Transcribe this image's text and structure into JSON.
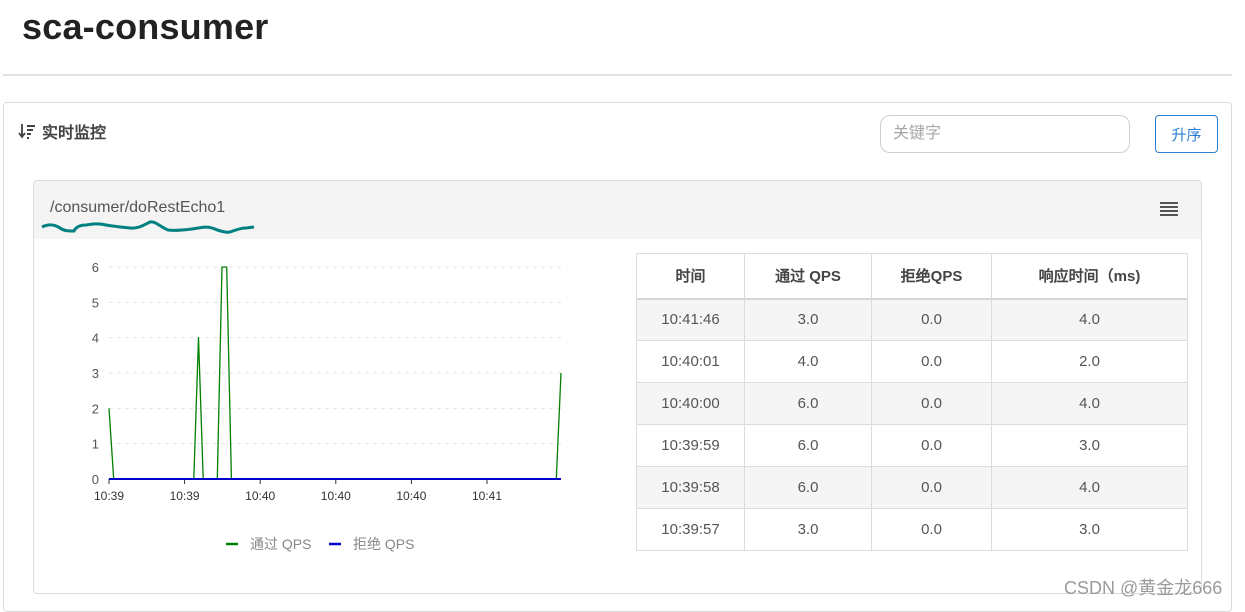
{
  "app": {
    "title": "sca-consumer"
  },
  "panel": {
    "heading": "实时监控",
    "search": {
      "placeholder": "关键字",
      "value": ""
    },
    "sort_button_label": "升序"
  },
  "resource": {
    "name": "/consumer/doRestEcho1",
    "table": {
      "columns": [
        "时间",
        "通过 QPS",
        "拒绝QPS",
        "响应时间（ms)"
      ],
      "rows": [
        [
          "10:41:46",
          "3.0",
          "0.0",
          "4.0"
        ],
        [
          "10:40:01",
          "4.0",
          "0.0",
          "2.0"
        ],
        [
          "10:40:00",
          "6.0",
          "0.0",
          "4.0"
        ],
        [
          "10:39:59",
          "6.0",
          "0.0",
          "3.0"
        ],
        [
          "10:39:58",
          "6.0",
          "0.0",
          "4.0"
        ],
        [
          "10:39:57",
          "3.0",
          "0.0",
          "3.0"
        ]
      ]
    }
  },
  "chart_data": {
    "type": "line",
    "x_tick_labels": [
      "10:39",
      "10:39",
      "10:40",
      "10:40",
      "10:40",
      "10:41"
    ],
    "y_ticks": [
      0,
      1,
      2,
      3,
      4,
      5,
      6
    ],
    "ylim": [
      0,
      6
    ],
    "grid": "horizontal-dashed",
    "legend_position": "bottom",
    "series": [
      {
        "name": "通过 QPS",
        "color": "#008000",
        "points": [
          [
            0,
            2
          ],
          [
            1,
            0
          ],
          [
            18,
            0
          ],
          [
            19,
            4
          ],
          [
            20,
            0
          ],
          [
            23,
            0
          ],
          [
            24,
            6
          ],
          [
            25,
            6
          ],
          [
            26,
            0
          ],
          [
            95,
            0
          ],
          [
            96,
            3
          ]
        ]
      },
      {
        "name": "拒绝 QPS",
        "color": "#0000cc",
        "points": [
          [
            0,
            0
          ],
          [
            96,
            0
          ]
        ]
      }
    ],
    "x_domain": [
      0,
      96
    ]
  },
  "colors": {
    "accent": "#2a7fd4",
    "pass": "#008000",
    "reject": "#0000cc",
    "sparkline": "#008080"
  },
  "watermark": "CSDN @黄金龙666"
}
